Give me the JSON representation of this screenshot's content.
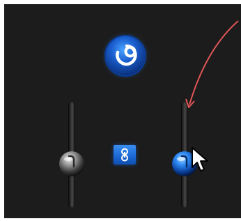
{
  "controls": {
    "power_button": {
      "icon": "power-ring-icon",
      "state": "on",
      "color": "#1e6ee6"
    },
    "left_slider": {
      "icon": "slider-knob-grey",
      "color": "#9a9a9a",
      "level": 0.38
    },
    "link_toggle": {
      "icon": "chain-link-icon",
      "state": "linked",
      "color": "#2a7ee8"
    },
    "right_slider": {
      "icon": "slider-knob-blue",
      "color": "#2f8cf5",
      "level": 0.38
    }
  },
  "cursor": {
    "icon": "arrow-cursor-icon"
  },
  "annotation": {
    "icon": "curved-arrow-icon",
    "color": "#e05555"
  }
}
